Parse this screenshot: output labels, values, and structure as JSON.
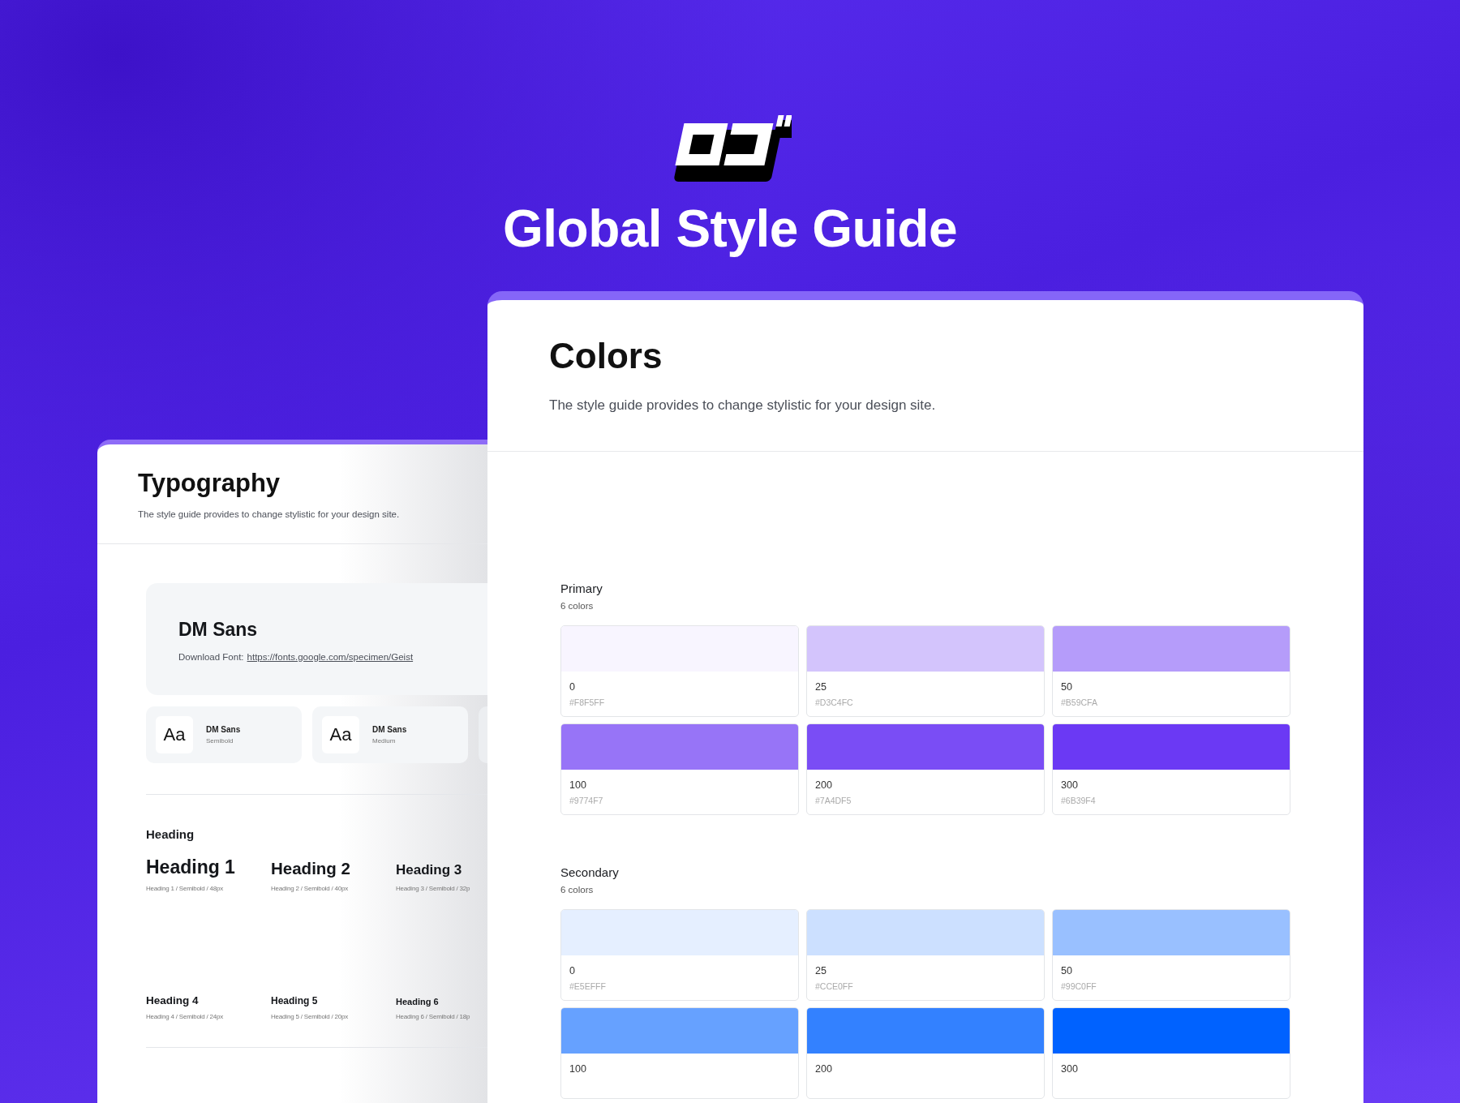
{
  "header": {
    "title": "Global Style Guide"
  },
  "typography": {
    "title": "Typography",
    "subtitle": "The style guide provides to change stylistic for your design site.",
    "font_card": {
      "name": "DM Sans",
      "download_label": "Download Font:",
      "download_link": "https://fonts.google.com/specimen/Geist"
    },
    "weights": [
      {
        "sample": "Aa",
        "name": "DM Sans",
        "weight": "Semibold"
      },
      {
        "sample": "Aa",
        "name": "DM Sans",
        "weight": "Medium"
      }
    ],
    "heading_section": "Heading",
    "headings": [
      {
        "label": "Heading 1",
        "spec": "Heading 1 / Semibold / 48px"
      },
      {
        "label": "Heading 2",
        "spec": "Heading 2 / Semibold / 40px"
      },
      {
        "label": "Heading 3",
        "spec": "Heading 3 / Semibold / 32p"
      },
      {
        "label": "Heading 4",
        "spec": "Heading 4 / Semibold / 24px"
      },
      {
        "label": "Heading 5",
        "spec": "Heading 5 / Semibold / 20px"
      },
      {
        "label": "Heading 6",
        "spec": "Heading 6 / Semibold / 18p"
      }
    ]
  },
  "colors": {
    "title": "Colors",
    "subtitle": "The style guide provides to change stylistic for your design site.",
    "groups": [
      {
        "name": "Primary",
        "count": "6 colors",
        "swatches": [
          {
            "step": "0",
            "hex": "#F8F5FF",
            "color": "#f8f5ff"
          },
          {
            "step": "25",
            "hex": "#D3C4FC",
            "color": "#d3c4fc"
          },
          {
            "step": "50",
            "hex": "#B59CFA",
            "color": "#b59cfa"
          },
          {
            "step": "100",
            "hex": "#9774F7",
            "color": "#9774f7"
          },
          {
            "step": "200",
            "hex": "#7A4DF5",
            "color": "#7a4df5"
          },
          {
            "step": "300",
            "hex": "#6B39F4",
            "color": "#6b39f4"
          }
        ]
      },
      {
        "name": "Secondary",
        "count": "6 colors",
        "swatches": [
          {
            "step": "0",
            "hex": "#E5EFFF",
            "color": "#e5efff"
          },
          {
            "step": "25",
            "hex": "#CCE0FF",
            "color": "#cce0ff"
          },
          {
            "step": "50",
            "hex": "#99C0FF",
            "color": "#99c0ff"
          },
          {
            "step": "100",
            "color": "#66a1ff"
          },
          {
            "step": "200",
            "color": "#3381ff"
          },
          {
            "step": "300",
            "color": "#0062ff"
          }
        ]
      }
    ]
  }
}
